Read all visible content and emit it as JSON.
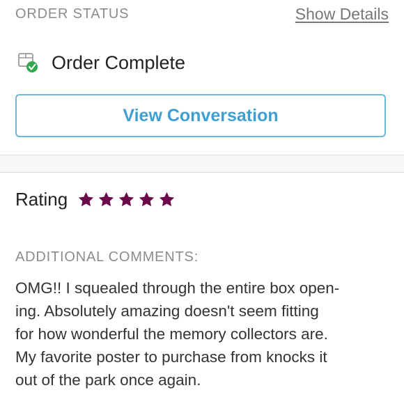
{
  "order_status": {
    "label": "ORDER STATUS",
    "show_details_label": "Show Details",
    "status_text": "Order Complete",
    "status_icon": "package-check-icon",
    "view_conversation_label": "View Conversation"
  },
  "rating": {
    "label": "Rating",
    "stars": 5,
    "max_stars": 5,
    "star_color": "#6b0a4b"
  },
  "comments": {
    "label": "ADDITIONAL COMMENTS:",
    "line_1": "OMG!! I squealed through the entire box open-",
    "line_2": "ing. Absolutely amazing doesn't seem fitting",
    "line_3": "for how wonderful the memory collectors are.",
    "line_4": "My favorite poster to purchase from knocks it",
    "line_5": "out of the park once again."
  },
  "colors": {
    "accent_blue": "#3f9fd2",
    "success_green": "#2fa84f",
    "muted_text": "#8c8c8c"
  }
}
